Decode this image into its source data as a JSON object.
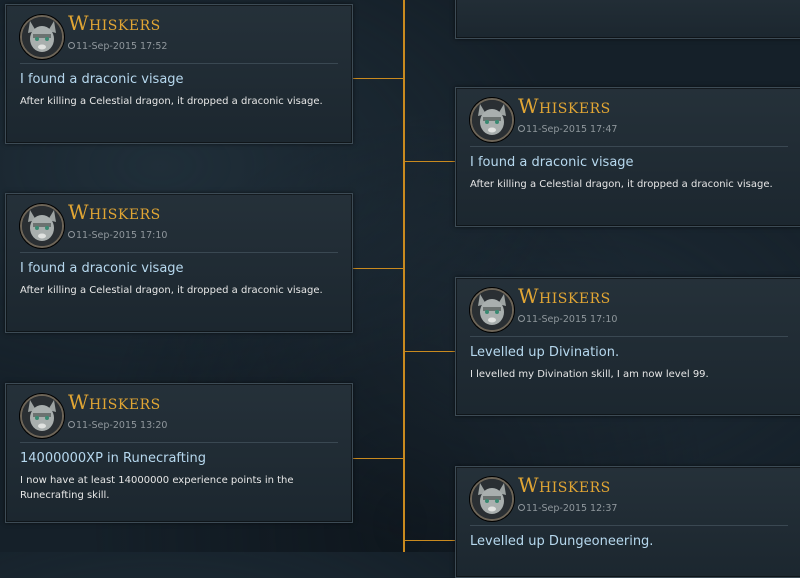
{
  "posts": [
    {
      "name": "Whiskers",
      "time": "11-Sep-2015 17:52",
      "title": "I found a draconic visage",
      "description": "After killing a Celestial dragon, it dropped a draconic visage."
    },
    {
      "name": "Whiskers",
      "time": "11-Sep-2015 17:47",
      "title": "I found a draconic visage",
      "description": "After killing a Celestial dragon, it dropped a draconic visage."
    },
    {
      "name": "Whiskers",
      "time": "11-Sep-2015 17:10",
      "title": "I found a draconic visage",
      "description": "After killing a Celestial dragon, it dropped a draconic visage."
    },
    {
      "name": "Whiskers",
      "time": "11-Sep-2015 17:10",
      "title": "Levelled up Divination.",
      "description": "I levelled my Divination skill, I am now level 99."
    },
    {
      "name": "Whiskers",
      "time": "11-Sep-2015 13:20",
      "title": "14000000XP in Runecrafting",
      "description": "I now have at least 14000000 experience points in the Runecrafting skill."
    },
    {
      "name": "Whiskers",
      "time": "11-Sep-2015 12:37",
      "title": "Levelled up Dungeoneering.",
      "description": ""
    }
  ],
  "colors": {
    "accent": "#c98a1f",
    "name": "#e0a534",
    "title": "#b6d8ee"
  },
  "icons": {
    "clock": "clock-icon",
    "avatar": "cat-avatar"
  }
}
